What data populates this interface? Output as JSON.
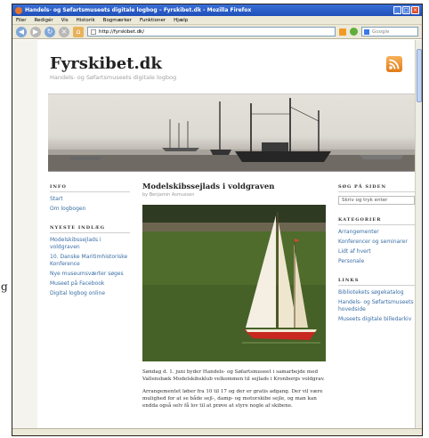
{
  "window": {
    "title": "Handels- og Søfartsmuseets digitale logbog – Fyrskibet.dk - Mozilla Firefox",
    "menu": [
      "Filer",
      "Redigér",
      "Vis",
      "Historik",
      "Bogmærker",
      "Funktioner",
      "Hjælp"
    ],
    "url": "http://fyrskibet.dk/",
    "search_placeholder": "Google"
  },
  "site": {
    "title": "Fyrskibet.dk",
    "tagline": "Handels- og Søfartsmuseets digitale logbog"
  },
  "left_sidebar": {
    "info_heading": "INFO",
    "info_links": [
      "Start",
      "Om logbogen"
    ],
    "recent_heading": "NYESTE INDLÆG",
    "recent_links": [
      "Modelskibssejlads i voldgraven",
      "10. Danske Maritimhistoriske Konference",
      "Nye museumsværter søges",
      "Museet på Facebook",
      "Digital logbog online"
    ]
  },
  "post": {
    "title": "Modelskibssejlads i voldgraven",
    "byline": "by Benjamin Asmussen",
    "paragraphs": [
      "Søndag d. 1. juni byder Handels- og Søfartsmuseet i samarbejde med Vallensbæk Modelskibsklub velkommen til sejlads i Kronborgs voldgrav.",
      "Arrangementet løber fra 10 til 17 og der er gratis adgang. Der vil være mulighed for at se både sejl-, damp- og motorskibe sejle, og man kan endda også selv få lov til at prøve at styre nogle af skibene."
    ]
  },
  "right_sidebar": {
    "search_heading": "SØG PÅ SIDEN",
    "search_placeholder": "Skriv og tryk enter",
    "categories_heading": "KATEGORIER",
    "categories": [
      "Arrangementer",
      "Konferencer og seminarer",
      "Lidt af hvert",
      "Personale"
    ],
    "links_heading": "LINKS",
    "links": [
      "Bibliotekets søgekatalog",
      "Handels- og Søfartsmuseets hovedside",
      "Museets digitale billedarkiv"
    ]
  },
  "icons": {
    "rss": "rss-feed-icon",
    "back": "back-arrow-icon",
    "forward": "forward-arrow-icon",
    "reload": "reload-icon",
    "stop": "stop-icon",
    "home": "home-icon"
  },
  "colors": {
    "link": "#3a6ea5",
    "title_bar": "#1e4fb8",
    "rss": "#e07b16"
  }
}
